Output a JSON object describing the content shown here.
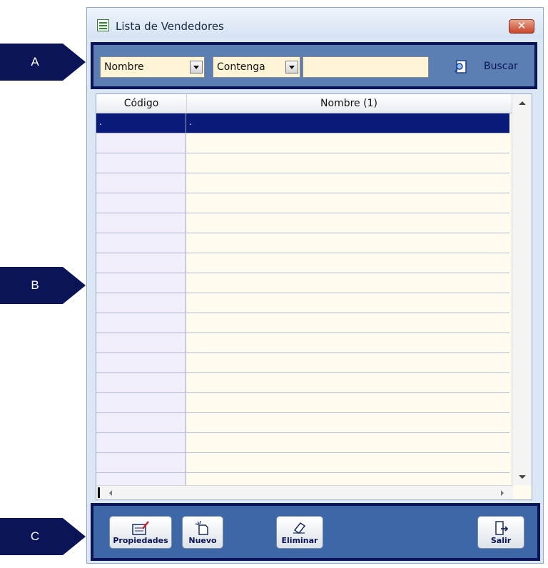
{
  "callouts": {
    "a": "A",
    "b": "B",
    "c": "C"
  },
  "window": {
    "title": "Lista de Vendedores",
    "close_glyph": "✕"
  },
  "search": {
    "field_select": "Nombre",
    "condition_select": "Contenga",
    "value": "",
    "buscar_label": "Buscar"
  },
  "grid": {
    "columns": [
      "Código",
      "Nombre (1)"
    ],
    "selected_row": {
      "codigo": ".",
      "nombre": "."
    },
    "empty_rows": 18
  },
  "actions": {
    "propiedades": "Propiedades",
    "nuevo": "Nuevo",
    "eliminar": "Eliminar",
    "salir": "Salir"
  },
  "colors": {
    "callout": "#0b1457",
    "selection": "#0a1a78",
    "panel": "#5b7fb3",
    "field_bg": "#fff5d6"
  }
}
